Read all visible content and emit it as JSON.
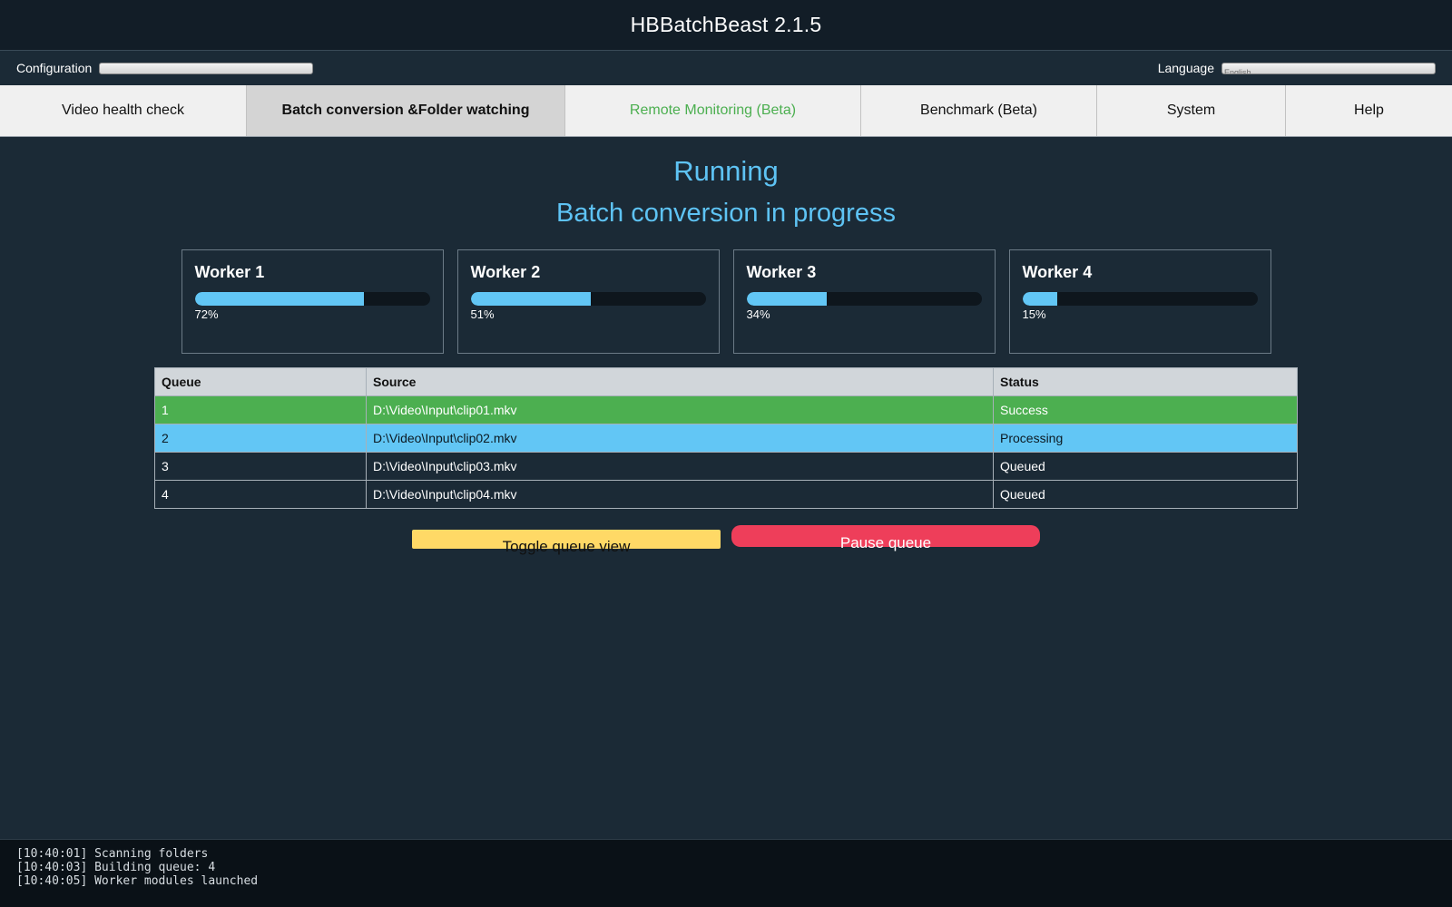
{
  "app": {
    "title": "HBBatchBeast 2.1.5"
  },
  "settings": {
    "configuration_label": "Configuration",
    "configuration_value": "",
    "language_label": "Language",
    "language_value": "English"
  },
  "tabs": [
    {
      "label": "Video health check",
      "active": false
    },
    {
      "label": "Batch conversion &Folder watching",
      "active": true
    },
    {
      "label": "Remote Monitoring (Beta)",
      "active": false
    },
    {
      "label": "Benchmark (Beta)",
      "active": false
    },
    {
      "label": "System",
      "active": false
    },
    {
      "label": "Help",
      "active": false
    }
  ],
  "status": {
    "title": "Running",
    "subtitle": "Batch conversion in progress"
  },
  "workers": [
    {
      "name": "Worker 1",
      "progress": 72,
      "progress_label": "72%"
    },
    {
      "name": "Worker 2",
      "progress": 51,
      "progress_label": "51%"
    },
    {
      "name": "Worker 3",
      "progress": 34,
      "progress_label": "34%"
    },
    {
      "name": "Worker 4",
      "progress": 15,
      "progress_label": "15%"
    }
  ],
  "queue": {
    "headers": [
      "Queue",
      "Source",
      "Status"
    ],
    "rows": [
      {
        "queue": "1",
        "source": "D:\\Video\\Input\\clip01.mkv",
        "status": "Success"
      },
      {
        "queue": "2",
        "source": "D:\\Video\\Input\\clip02.mkv",
        "status": "Processing"
      },
      {
        "queue": "3",
        "source": "D:\\Video\\Input\\clip03.mkv",
        "status": "Queued"
      },
      {
        "queue": "4",
        "source": "D:\\Video\\Input\\clip04.mkv",
        "status": "Queued"
      }
    ]
  },
  "actions": {
    "toggle_label": "Toggle queue view",
    "pause_label": "Pause queue"
  },
  "log": [
    "[10:40:01] Scanning folders",
    "[10:40:03] Building queue: 4",
    "[10:40:05] Worker modules launched"
  ],
  "colors": {
    "accent_blue": "#62c6f5",
    "success_green": "#4caf50",
    "toggle_yellow": "#ffd966",
    "pause_red": "#ee3e5a"
  }
}
